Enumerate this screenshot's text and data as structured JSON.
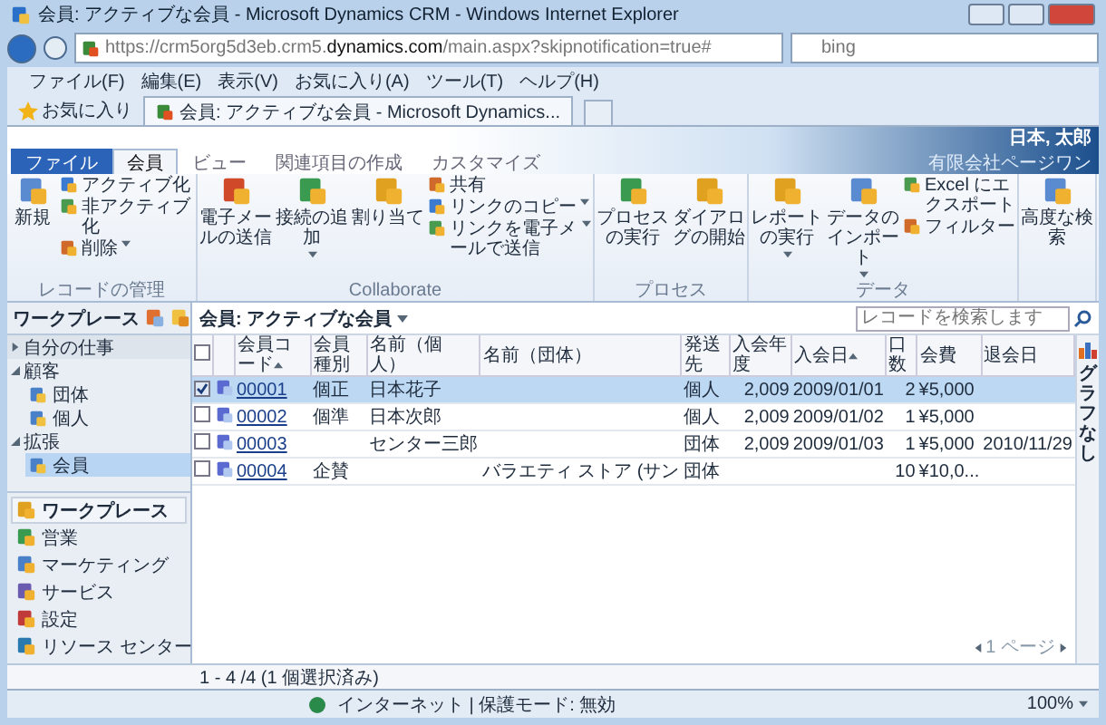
{
  "window": {
    "title": "会員: アクティブな会員 - Microsoft Dynamics CRM - Windows Internet Explorer"
  },
  "address_bar": {
    "url": "https://crm5org5d3eb.crm5.**dynamics.com**/main.aspx?skipnotification=true#"
  },
  "search": {
    "placeholder": "bing"
  },
  "menu": [
    "ファイル(F)",
    "編集(E)",
    "表示(V)",
    "お気に入り(A)",
    "ツール(T)",
    "ヘルプ(H)"
  ],
  "favorites": {
    "label": "お気に入り"
  },
  "browser_tabs": [
    {
      "label": "会員: アクティブな会員 - Microsoft Dynamics...",
      "selected": true
    }
  ],
  "crm_header": {
    "user": "日本, 太郎",
    "organization": "有限会社ページワン"
  },
  "ribbon_tabs": [
    {
      "label": "ファイル",
      "kind": "file",
      "selected": false
    },
    {
      "label": "会員",
      "kind": "tab",
      "selected": true
    },
    {
      "label": "ビュー",
      "kind": "tab",
      "selected": false
    },
    {
      "label": "関連項目の作成",
      "kind": "tab",
      "selected": false
    },
    {
      "label": "カスタマイズ",
      "kind": "tab",
      "selected": false
    }
  ],
  "ribbon_groups": [
    {
      "label": "レコードの管理",
      "items": [
        {
          "label": "新規",
          "kind": "large",
          "dropdown": false
        },
        {
          "label": "アクティブ化",
          "kind": "small",
          "dropdown": false
        },
        {
          "label": "非アクティブ化",
          "kind": "small",
          "dropdown": false
        },
        {
          "label": "削除",
          "kind": "small",
          "dropdown": true
        }
      ]
    },
    {
      "label": "Collaborate",
      "items": [
        {
          "label": "電子メールの送信",
          "kind": "large",
          "dropdown": false
        },
        {
          "label": "接続の追加",
          "kind": "large",
          "dropdown": true
        },
        {
          "label": "割り当て",
          "kind": "large",
          "dropdown": false
        },
        {
          "label": "共有",
          "kind": "small",
          "dropdown": false
        },
        {
          "label": "リンクのコピー",
          "kind": "small",
          "dropdown": true
        },
        {
          "label": "リンクを電子メールで送信",
          "kind": "small",
          "dropdown": true
        }
      ]
    },
    {
      "label": "プロセス",
      "items": [
        {
          "label": "プロセスの実行",
          "kind": "large",
          "dropdown": false
        },
        {
          "label": "ダイアログの開始",
          "kind": "large",
          "dropdown": false
        }
      ]
    },
    {
      "label": "データ",
      "items": [
        {
          "label": "レポートの実行",
          "kind": "large",
          "dropdown": true
        },
        {
          "label": "データのインポート",
          "kind": "large",
          "dropdown": true
        },
        {
          "label": "Excel にエクスポート",
          "kind": "small",
          "dropdown": false
        },
        {
          "label": "フィルター",
          "kind": "small",
          "dropdown": false
        }
      ]
    },
    {
      "items": [
        {
          "label": "高度な検索",
          "kind": "large",
          "dropdown": false
        }
      ]
    }
  ],
  "workplace": {
    "title": "ワークプレース"
  },
  "sidebar_tree": [
    {
      "label": "自分の仕事",
      "expanded": false
    },
    {
      "label": "顧客",
      "expanded": true,
      "children": [
        {
          "label": "団体",
          "selected": false
        },
        {
          "label": "個人",
          "selected": false
        }
      ]
    },
    {
      "label": "拡張",
      "expanded": true,
      "children": [
        {
          "label": "会員",
          "selected": true
        }
      ]
    }
  ],
  "nav": [
    {
      "label": "ワークプレース",
      "selected": true
    },
    {
      "label": "営業",
      "selected": false
    },
    {
      "label": "マーケティング",
      "selected": false
    },
    {
      "label": "サービス",
      "selected": false
    },
    {
      "label": "設定",
      "selected": false
    },
    {
      "label": "リソース センター",
      "selected": false
    }
  ],
  "view": {
    "title": "会員: アクティブな会員",
    "search_placeholder": "レコードを検索します"
  },
  "table": {
    "select_all": {
      "checked": false
    },
    "columns": [
      {
        "label": "会員コード",
        "sorted": true
      },
      {
        "label": "会員種別",
        "sorted": false
      },
      {
        "label": "名前（個人）",
        "sorted": false
      },
      {
        "label": "名前（団体）",
        "sorted": false
      },
      {
        "label": "発送先",
        "sorted": false
      },
      {
        "label": "入会年度",
        "sorted": false
      },
      {
        "label": "入会日",
        "sorted": true
      },
      {
        "label": "口数",
        "sorted": false
      },
      {
        "label": "会費",
        "sorted": false
      },
      {
        "label": "退会日",
        "sorted": false
      }
    ],
    "rows": [
      {
        "selected": true,
        "checked": true,
        "cells": [
          "00001",
          "個正",
          "日本花子",
          "",
          "個人",
          "2,009",
          "2009/01/01",
          "2",
          "¥5,000",
          ""
        ]
      },
      {
        "selected": false,
        "checked": false,
        "cells": [
          "00002",
          "個準",
          "日本次郎",
          "",
          "個人",
          "2,009",
          "2009/01/02",
          "1",
          "¥5,000",
          ""
        ]
      },
      {
        "selected": false,
        "checked": false,
        "cells": [
          "00003",
          "",
          "センター三郎",
          "",
          "団体",
          "2,009",
          "2009/01/03",
          "1",
          "¥5,000",
          "2010/11/29"
        ]
      },
      {
        "selected": false,
        "checked": false,
        "cells": [
          "00004",
          "企賛",
          "",
          "バラエティ ストア (サン",
          "団体",
          "",
          "",
          "10",
          "¥10,0...",
          ""
        ]
      }
    ]
  },
  "record_count": "1 - 4 /4 (1 個選択済み)",
  "pager": {
    "page": "1 ページ"
  },
  "chart_pane": {
    "label": "グラフなし"
  },
  "status_bar": {
    "zone": "インターネット | 保護モード: 無効",
    "zoom": "100%"
  }
}
